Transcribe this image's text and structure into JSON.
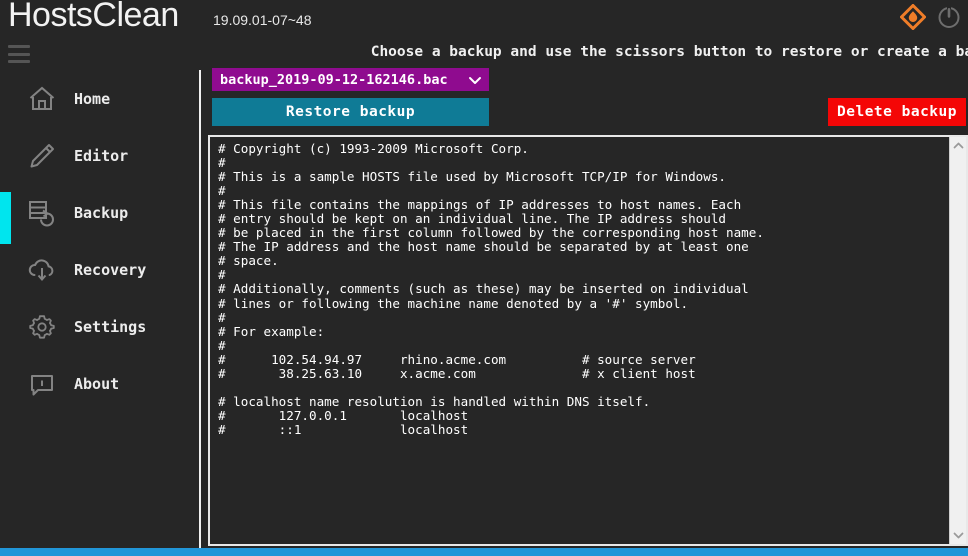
{
  "window": {
    "app_title": "HostsClean",
    "version": "19.09.01-07~48"
  },
  "topbar": {
    "logo_icon": "flame-diamond-logo-icon",
    "power_icon": "power-icon",
    "menu_icon": "hamburger-menu-icon"
  },
  "sidebar": {
    "items": [
      {
        "label": "Home",
        "icon": "home-icon",
        "active": false
      },
      {
        "label": "Editor",
        "icon": "pencil-icon",
        "active": false
      },
      {
        "label": "Backup",
        "icon": "database-backup-icon",
        "active": true
      },
      {
        "label": "Recovery",
        "icon": "cloud-download-icon",
        "active": false
      },
      {
        "label": "Settings",
        "icon": "gear-icon",
        "active": false
      },
      {
        "label": "About",
        "icon": "info-bubble-icon",
        "active": false
      }
    ]
  },
  "main": {
    "instruction": "Choose a backup and use the scissors button to restore or create a backup",
    "backup_select": {
      "selected": "backup_2019-09-12-162146.bac",
      "chevron_icon": "chevron-down-icon",
      "options": [
        "backup_2019-09-12-162146.bac"
      ]
    },
    "restore_label": "Restore backup",
    "delete_label": "Delete backup",
    "scrollbar": {
      "up_icon": "chevron-up-icon",
      "down_icon": "chevron-down-icon"
    },
    "hosts_file_text": "# Copyright (c) 1993-2009 Microsoft Corp.\n#\n# This is a sample HOSTS file used by Microsoft TCP/IP for Windows.\n#\n# This file contains the mappings of IP addresses to host names. Each\n# entry should be kept on an individual line. The IP address should\n# be placed in the first column followed by the corresponding host name.\n# The IP address and the host name should be separated by at least one\n# space.\n#\n# Additionally, comments (such as these) may be inserted on individual\n# lines or following the machine name denoted by a '#' symbol.\n#\n# For example:\n#\n#      102.54.94.97     rhino.acme.com          # source server\n#       38.25.63.10     x.acme.com              # x client host\n\n# localhost name resolution is handled within DNS itself.\n#       127.0.0.1       localhost\n#       ::1             localhost"
  },
  "colors": {
    "accent_cyan": "#00e5ee",
    "dropdown_purple": "#8f0b8f",
    "restore_teal": "#0f7b96",
    "delete_red": "#f40606",
    "status_blue": "#2196d8",
    "logo_orange": "#ef7d28",
    "background": "#262626"
  }
}
